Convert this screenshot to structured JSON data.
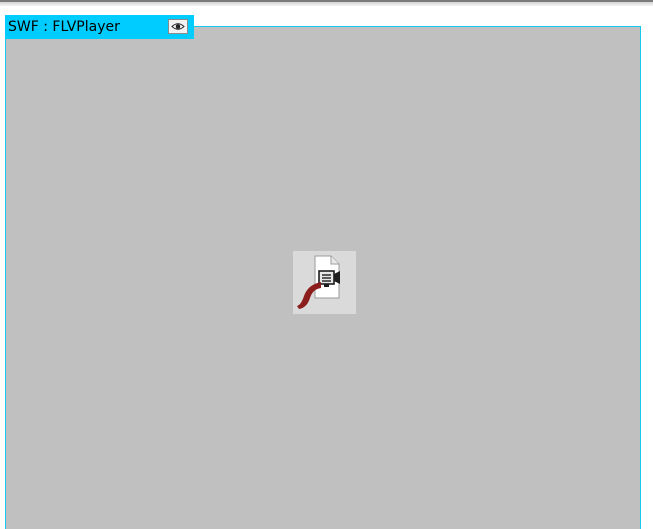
{
  "swf_object": {
    "label": "SWF : FLVPlayer",
    "toggle_icon": "eye-icon",
    "placeholder_icon": "flash-video-icon"
  },
  "colors": {
    "frame_border": "#17c7ee",
    "tab_background": "#00ccff",
    "canvas_background": "#c0c0c0"
  }
}
